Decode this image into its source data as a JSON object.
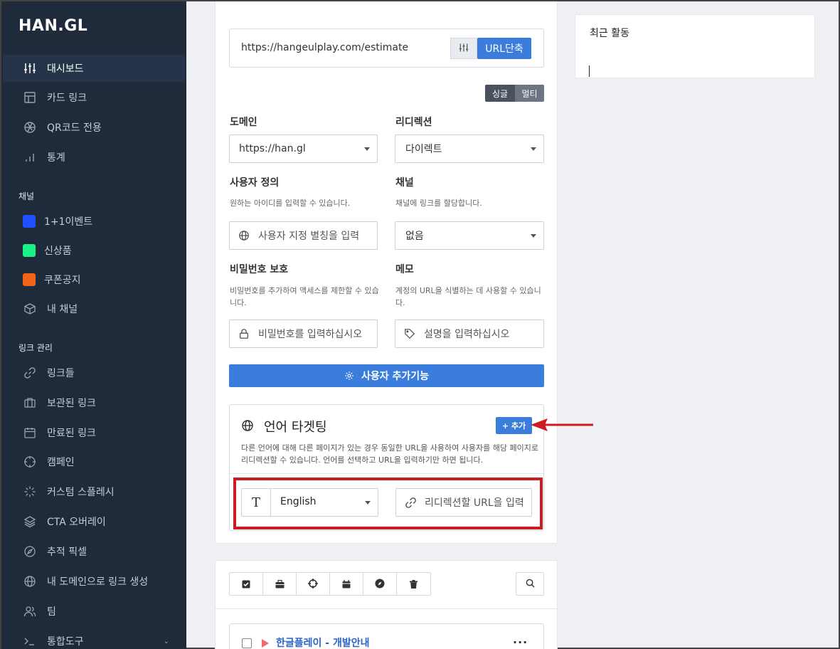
{
  "sidebar": {
    "logo": "HAN.GL",
    "main_items": [
      {
        "label": "대시보드",
        "icon": "sliders-icon"
      },
      {
        "label": "카드 링크",
        "icon": "layout-icon"
      },
      {
        "label": "QR코드 전용",
        "icon": "aperture-icon"
      },
      {
        "label": "통계",
        "icon": "bar-chart-icon"
      }
    ],
    "channels_label": "채널",
    "channels": [
      {
        "label": "1+1이벤트",
        "color": "#1f4fff"
      },
      {
        "label": "신상품",
        "color": "#19f28a"
      },
      {
        "label": "쿠폰공지",
        "color": "#f26419"
      },
      {
        "label": "내 채널",
        "icon": "box-icon"
      }
    ],
    "links_label": "링크 관리",
    "link_items": [
      {
        "label": "링크들",
        "icon": "link-icon"
      },
      {
        "label": "보관된 링크",
        "icon": "briefcase-icon"
      },
      {
        "label": "만료된 링크",
        "icon": "calendar-icon"
      },
      {
        "label": "캠페인",
        "icon": "crosshair-icon"
      },
      {
        "label": "커스텀 스플레시",
        "icon": "loader-icon"
      },
      {
        "label": "CTA 오버레이",
        "icon": "layers-icon"
      },
      {
        "label": "추적 픽셀",
        "icon": "compass-icon"
      },
      {
        "label": "내 도메인으로 링크 생성",
        "icon": "globe-icon"
      },
      {
        "label": "팀",
        "icon": "users-icon"
      },
      {
        "label": "통합도구",
        "icon": "terminal-icon"
      }
    ]
  },
  "form": {
    "url_value": "https://hangeulplay.com/estimate",
    "shorten_button": "URL단축",
    "mode_single": "싱글",
    "mode_multi": "멀티",
    "domain_label": "도메인",
    "domain_value": "https://han.gl",
    "redirect_label": "리디렉션",
    "redirect_value": "다이렉트",
    "custom_label": "사용자 정의",
    "custom_hint": "원하는 아이디를 입력할 수 있습니다.",
    "custom_placeholder": "사용자 지정 별칭을 입력",
    "channel_label": "채널",
    "channel_hint": "채널에 링크를 할당합니다.",
    "channel_value": "없음",
    "password_label": "비밀번호 보호",
    "password_hint": "비밀번호를 추가하여 액세스를 제한할 수 있습니다.",
    "password_placeholder": "비밀번호를 입력하십시오",
    "memo_label": "메모",
    "memo_hint": "계정의 URL을 식별하는 데 사용할 수 있습니다.",
    "memo_placeholder": "설명을 입력하십시오",
    "features_button": "사용자 추가기능"
  },
  "language": {
    "title": "언어 타겟팅",
    "add_button": "+ 추가",
    "description": "다른 언어에 대해 다른 페이지가 있는 경우 동일한 URL을 사용하여 사용자를 해당 페이지로 리디렉션할 수 있습니다. 언어를 선택하고 URL을 입력하기만 하면 됩니다.",
    "language_value": "English",
    "url_placeholder": "리디렉션할 URL을 입력"
  },
  "activity": {
    "title": "최근 활동"
  },
  "links_list": {
    "first_link_title": "한글플레이 - 개발안내",
    "more": "..."
  }
}
